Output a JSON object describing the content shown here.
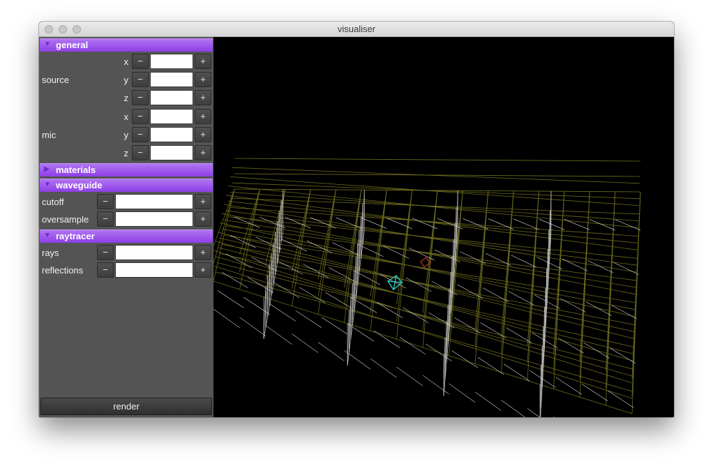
{
  "window": {
    "title": "visualiser"
  },
  "sidebar": {
    "sections": {
      "general": {
        "label": "general",
        "expanded": true
      },
      "materials": {
        "label": "materials",
        "expanded": false
      },
      "waveguide": {
        "label": "waveguide",
        "expanded": true
      },
      "raytracer": {
        "label": "raytracer",
        "expanded": true
      }
    },
    "general": {
      "source": {
        "label": "source",
        "axes": [
          "x",
          "y",
          "z"
        ],
        "values": [
          "",
          "",
          ""
        ]
      },
      "mic": {
        "label": "mic",
        "axes": [
          "x",
          "y",
          "z"
        ],
        "values": [
          "",
          "",
          ""
        ]
      }
    },
    "waveguide": {
      "cutoff": {
        "label": "cutoff",
        "value": ""
      },
      "oversample": {
        "label": "oversample",
        "value": ""
      }
    },
    "raytracer": {
      "rays": {
        "label": "rays",
        "value": ""
      },
      "reflections": {
        "label": "reflections",
        "value": ""
      }
    },
    "buttons": {
      "minus": "−",
      "plus": "+"
    },
    "render_label": "render"
  },
  "icons": {
    "expanded": "triangle-down-icon",
    "collapsed": "triangle-right-icon"
  },
  "colors": {
    "section_header": "#9b55ee",
    "sidebar_bg": "#545454",
    "viewport_bg": "#000000",
    "mesh_primary": "#6b6a1e",
    "mesh_secondary": "#d8d8d8",
    "source_marker": "#2fd3c8",
    "mic_marker": "#c0392b"
  }
}
